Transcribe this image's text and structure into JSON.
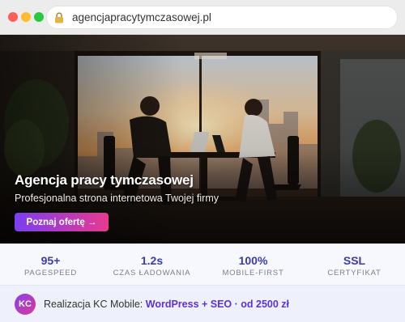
{
  "browser": {
    "url": "agencjapracytymczasowej.pl",
    "traffic_lights": [
      "#ff5f57",
      "#febc2e",
      "#28c840"
    ]
  },
  "hero": {
    "title": "Agencja pracy tymczasowej",
    "subtitle": "Profesjonalna strona internetowa Twojej firmy",
    "cta_label": "Poznaj ofertę →"
  },
  "stats": [
    {
      "value": "95+",
      "label": "PAGESPEED"
    },
    {
      "value": "1.2s",
      "label": "CZAS ŁADOWANIA"
    },
    {
      "value": "100%",
      "label": "MOBILE-FIRST"
    },
    {
      "value": "SSL",
      "label": "CERTYFIKAT"
    }
  ],
  "footer": {
    "avatar": "KC",
    "prefix": "Realizacja KC Mobile: ",
    "highlight": "WordPress + SEO · od 2500 zł"
  },
  "colors": {
    "accent": "#3b3ab3",
    "cta_start": "#7b3ff0",
    "cta_end": "#e8398f"
  }
}
